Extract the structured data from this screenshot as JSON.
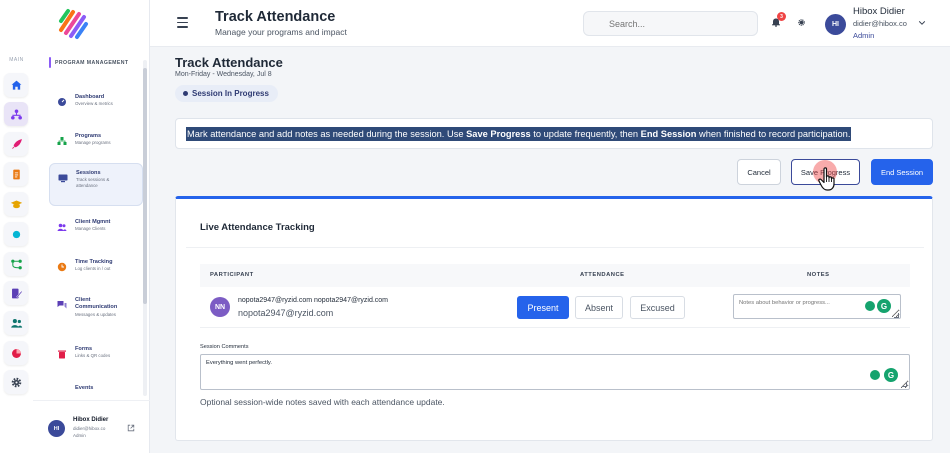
{
  "app": {
    "brand_colors": {
      "accent": "#2563eb",
      "primary_dark": "#2f3b73",
      "success": "#15a36e",
      "danger": "#ef4444"
    }
  },
  "rail": {
    "label": "MAIN",
    "icons": [
      "home-icon",
      "hierarchy-icon",
      "rocket-icon",
      "document-icon",
      "graduation-cap-icon",
      "circle-icon",
      "flow-icon",
      "edit-doc-icon",
      "users-icon",
      "pie-chart-icon",
      "gear-icon"
    ]
  },
  "sidebar": {
    "section_title": "PROGRAM MANAGEMENT",
    "items": [
      {
        "title": "Dashboard",
        "subtitle": "Overview & metrics",
        "icon": "dashboard-icon"
      },
      {
        "title": "Programs",
        "subtitle": "Manage programs",
        "icon": "sitemap-icon"
      },
      {
        "title": "Sessions",
        "subtitle": "Track sessions &",
        "subtitle2": "attendance",
        "icon": "monitor-icon",
        "active": true
      },
      {
        "title": "Client Mgmnt",
        "subtitle": "Manage Clients",
        "icon": "users-icon"
      },
      {
        "title": "Time Tracking",
        "subtitle": "Log clients in / out",
        "icon": "clock-icon"
      },
      {
        "title": "Client",
        "title2": "Communication",
        "subtitle": "Messages & updates",
        "icon": "chat-icon"
      },
      {
        "title": "Forms",
        "subtitle": "Links & QR codes",
        "icon": "trash-icon"
      },
      {
        "title": "Events",
        "subtitle": "",
        "icon": "calendar-icon"
      }
    ],
    "user": {
      "initials": "HI",
      "name": "Hibox Didier",
      "email": "didier@hibox.co",
      "role": "Admin"
    }
  },
  "header": {
    "title": "Track Attendance",
    "subtitle": "Manage your programs and impact",
    "search_placeholder": "Search...",
    "notification_count": "3",
    "user": {
      "initials": "HI",
      "name": "Hibox Didier",
      "email": "didier@hibox.co",
      "role": "Admin"
    }
  },
  "page": {
    "title": "Track Attendance",
    "schedule": "Mon-Friday - Wednesday, Jul 8",
    "status": "Session In Progress",
    "info": {
      "part1": "Mark attendance and add notes as needed during the session. Use ",
      "bold1": "Save Progress",
      "part2": " to update frequently, then ",
      "bold2": "End Session",
      "part3": " when finished to record participation."
    },
    "buttons": {
      "cancel": "Cancel",
      "save": "Save Progress",
      "end": "End Session"
    }
  },
  "card": {
    "title": "Live Attendance Tracking",
    "columns": {
      "participant": "PARTICIPANT",
      "attendance": "ATTENDANCE",
      "notes": "NOTES"
    },
    "rows": [
      {
        "initials": "NN",
        "name": "nopota2947@ryzid.com nopota2947@ryzid.com",
        "email": "nopota2947@ryzid.com",
        "options": {
          "present": "Present",
          "absent": "Absent",
          "excused": "Excused"
        },
        "selected": "Present",
        "notes_placeholder": "Notes about behavior or progress..."
      }
    ],
    "session_comments": {
      "label": "Session Comments",
      "value": "Everything went perfectly.",
      "help": "Optional session-wide notes saved with each attendance update."
    }
  }
}
